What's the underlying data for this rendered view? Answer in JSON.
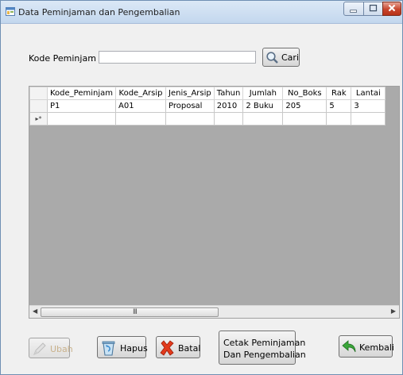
{
  "window": {
    "title": "Data Peminjaman dan Pengembalian"
  },
  "search": {
    "label": "Kode Peminjam",
    "separator": ":",
    "value": "",
    "button_label": "Cari"
  },
  "grid": {
    "columns": [
      "Kode_Peminjam",
      "Kode_Arsip",
      "Jenis_Arsip",
      "Tahun",
      "Jumlah",
      "No_Boks",
      "Rak",
      "Lantai"
    ],
    "rows": [
      [
        "P1",
        "A01",
        "Proposal",
        "2010",
        "2 Buku",
        "205",
        "5",
        "3"
      ]
    ],
    "new_row_marker": "▸*",
    "scroll_grip": "III"
  },
  "buttons": {
    "ubah": "Ubah",
    "hapus": "Hapus",
    "batal": "Batal",
    "cetak_line1": "Cetak Peminjaman",
    "cetak_line2": "Dan Pengembalian",
    "kembali": "Kembali"
  }
}
